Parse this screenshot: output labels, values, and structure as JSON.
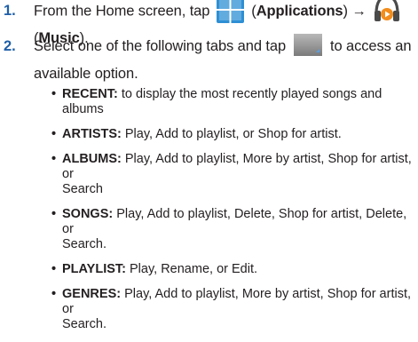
{
  "steps": [
    {
      "number": "1.",
      "text_before_apps": "From the Home screen, tap",
      "apps_label": "Applications",
      "arrow": "→",
      "music_label": "Music",
      "icons": [
        "applications-icon",
        "music-headphones-icon"
      ]
    },
    {
      "number": "2.",
      "text_before_icon": "Select one of the following tabs and tap",
      "text_after_icon": "to access an",
      "line2": "available option.",
      "icons": [
        "menu-key-icon"
      ]
    }
  ],
  "tabs": [
    {
      "label": "RECENT:",
      "lines": [
        "to display the most recently played songs and albums"
      ]
    },
    {
      "label": "ARTISTS:",
      "lines": [
        "Play, Add to playlist, or Shop for artist."
      ]
    },
    {
      "label": "ALBUMS:",
      "lines": [
        "Play, Add to playlist, More by artist, Shop for artist, or",
        "Search"
      ]
    },
    {
      "label": "SONGS:",
      "lines": [
        "Play, Add to playlist, Delete, Shop for artist, Delete, or",
        "Search."
      ]
    },
    {
      "label": "PLAYLIST:",
      "lines": [
        "Play, Rename, or Edit."
      ]
    },
    {
      "label": "GENRES:",
      "lines": [
        "Play, Add to playlist, More by artist, Shop for artist, or",
        "Search."
      ]
    }
  ],
  "colors": {
    "step_number": "#1f5fa8",
    "text": "#231f20",
    "apps_icon_blue": "#2e8fd4",
    "music_icon_orange": "#f28c1b"
  }
}
